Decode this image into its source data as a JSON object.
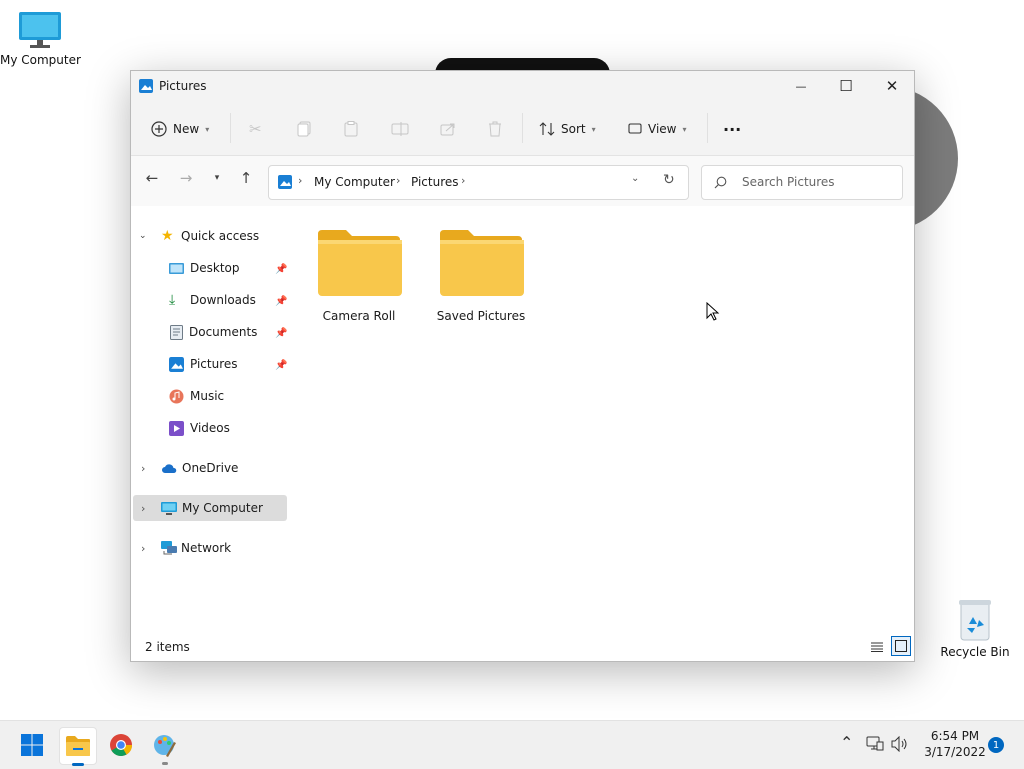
{
  "desktop": {
    "icons": [
      {
        "label": "My Computer"
      },
      {
        "label": "Recycle Bin"
      }
    ]
  },
  "window": {
    "title": "Pictures",
    "controls": {
      "minimize": "—",
      "maximize": "☐",
      "close": "✕"
    }
  },
  "commandbar": {
    "new_label": "New",
    "sort_label": "Sort",
    "view_label": "View",
    "more_label": "···"
  },
  "navigation": {
    "breadcrumb": [
      "My Computer",
      "Pictures"
    ],
    "search_placeholder": "Search Pictures"
  },
  "sidebar": {
    "quick_access": "Quick access",
    "items": [
      {
        "label": "Desktop",
        "icon": "desktop-icon",
        "pinned": true
      },
      {
        "label": "Downloads",
        "icon": "downloads-icon",
        "pinned": true
      },
      {
        "label": "Documents",
        "icon": "documents-icon",
        "pinned": true
      },
      {
        "label": "Pictures",
        "icon": "pictures-icon",
        "pinned": true
      },
      {
        "label": "Music",
        "icon": "music-icon",
        "pinned": false
      },
      {
        "label": "Videos",
        "icon": "videos-icon",
        "pinned": false
      }
    ],
    "onedrive": "OneDrive",
    "my_computer": "My Computer",
    "network": "Network"
  },
  "content": {
    "folders": [
      {
        "name": "Camera Roll"
      },
      {
        "name": "Saved Pictures"
      }
    ]
  },
  "status": {
    "count": "2 items"
  },
  "taskbar": {
    "time": "6:54 PM",
    "date": "3/17/2022",
    "notification_count": "1"
  },
  "colors": {
    "accent": "#0067c0",
    "folder": "#f8c74b",
    "folder_dark": "#e8a91e"
  }
}
